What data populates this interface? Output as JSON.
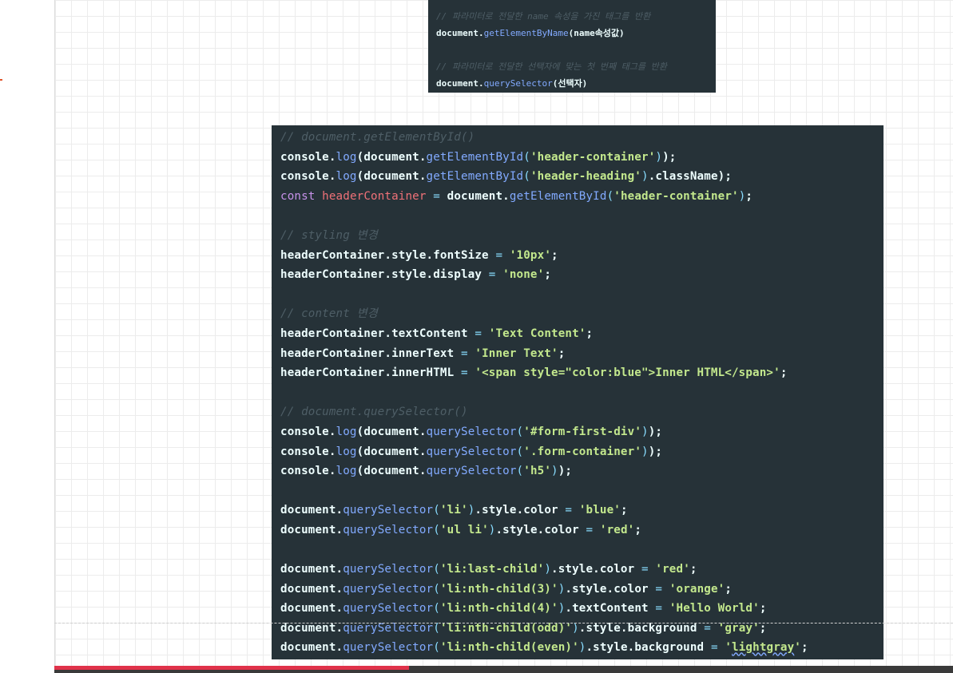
{
  "top_snippet": {
    "comment1": "// 파라미터로 전달한 name 속성을 가진 태그를 반환",
    "line1_obj": "document.",
    "line1_fn": "getElementByName",
    "line1_arg": "(name속성값)",
    "comment2": "// 파라미터로 전달한 선택자에 맞는 첫 번째 태그를 반환",
    "line2_obj": "document.",
    "line2_fn": "querySelector",
    "line2_arg": "(선택자)"
  },
  "main_code": {
    "c1": "// document.getElementById()",
    "c2": "// styling 변경",
    "c3": "// content 변경",
    "c4": "// document.querySelector()"
  },
  "video_progress": 0.395,
  "colors": {
    "code_bg": "#263238",
    "progress": "#e0324a"
  }
}
